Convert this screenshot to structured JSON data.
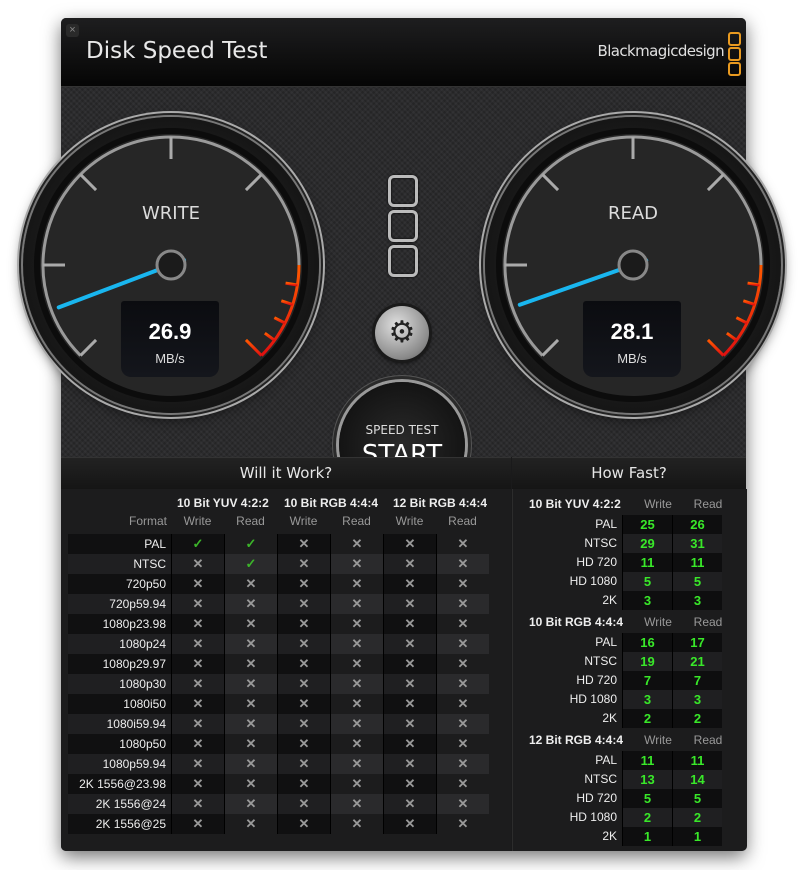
{
  "window": {
    "title": "Disk Speed Test",
    "brand": "Blackmagicdesign",
    "close_icon": "close-icon"
  },
  "gauges": {
    "write": {
      "label": "WRITE",
      "value": "26.9",
      "unit": "MB/s",
      "needle_fraction": 0.09
    },
    "read": {
      "label": "READ",
      "value": "28.1",
      "unit": "MB/s",
      "needle_fraction": 0.095
    }
  },
  "controls": {
    "settings_icon": "gear-icon",
    "start_sub": "SPEED TEST",
    "start_main": "START"
  },
  "will_it_work": {
    "title": "Will it Work?",
    "format_label": "Format",
    "groups": [
      "10 Bit YUV 4:2:2",
      "10 Bit RGB 4:4:4",
      "12 Bit RGB 4:4:4"
    ],
    "subcols": [
      "Write",
      "Read",
      "Write",
      "Read",
      "Write",
      "Read"
    ],
    "rows": [
      {
        "format": "PAL",
        "results": [
          true,
          true,
          false,
          false,
          false,
          false
        ]
      },
      {
        "format": "NTSC",
        "results": [
          false,
          true,
          false,
          false,
          false,
          false
        ]
      },
      {
        "format": "720p50",
        "results": [
          false,
          false,
          false,
          false,
          false,
          false
        ]
      },
      {
        "format": "720p59.94",
        "results": [
          false,
          false,
          false,
          false,
          false,
          false
        ]
      },
      {
        "format": "1080p23.98",
        "results": [
          false,
          false,
          false,
          false,
          false,
          false
        ]
      },
      {
        "format": "1080p24",
        "results": [
          false,
          false,
          false,
          false,
          false,
          false
        ]
      },
      {
        "format": "1080p29.97",
        "results": [
          false,
          false,
          false,
          false,
          false,
          false
        ]
      },
      {
        "format": "1080p30",
        "results": [
          false,
          false,
          false,
          false,
          false,
          false
        ]
      },
      {
        "format": "1080i50",
        "results": [
          false,
          false,
          false,
          false,
          false,
          false
        ]
      },
      {
        "format": "1080i59.94",
        "results": [
          false,
          false,
          false,
          false,
          false,
          false
        ]
      },
      {
        "format": "1080p50",
        "results": [
          false,
          false,
          false,
          false,
          false,
          false
        ]
      },
      {
        "format": "1080p59.94",
        "results": [
          false,
          false,
          false,
          false,
          false,
          false
        ]
      },
      {
        "format": "2K 1556@23.98",
        "results": [
          false,
          false,
          false,
          false,
          false,
          false
        ]
      },
      {
        "format": "2K 1556@24",
        "results": [
          false,
          false,
          false,
          false,
          false,
          false
        ]
      },
      {
        "format": "2K 1556@25",
        "results": [
          false,
          false,
          false,
          false,
          false,
          false
        ]
      }
    ],
    "check_glyph": "✓",
    "cross_glyph": "✕"
  },
  "how_fast": {
    "title": "How Fast?",
    "write_label": "Write",
    "read_label": "Read",
    "groups": [
      {
        "name": "10 Bit YUV 4:2:2",
        "rows": [
          {
            "label": "PAL",
            "write": "25",
            "read": "26"
          },
          {
            "label": "NTSC",
            "write": "29",
            "read": "31"
          },
          {
            "label": "HD 720",
            "write": "11",
            "read": "11"
          },
          {
            "label": "HD 1080",
            "write": "5",
            "read": "5"
          },
          {
            "label": "2K",
            "write": "3",
            "read": "3"
          }
        ]
      },
      {
        "name": "10 Bit RGB 4:4:4",
        "rows": [
          {
            "label": "PAL",
            "write": "16",
            "read": "17"
          },
          {
            "label": "NTSC",
            "write": "19",
            "read": "21"
          },
          {
            "label": "HD 720",
            "write": "7",
            "read": "7"
          },
          {
            "label": "HD 1080",
            "write": "3",
            "read": "3"
          },
          {
            "label": "2K",
            "write": "2",
            "read": "2"
          }
        ]
      },
      {
        "name": "12 Bit RGB 4:4:4",
        "rows": [
          {
            "label": "PAL",
            "write": "11",
            "read": "11"
          },
          {
            "label": "NTSC",
            "write": "13",
            "read": "14"
          },
          {
            "label": "HD 720",
            "write": "5",
            "read": "5"
          },
          {
            "label": "HD 1080",
            "write": "2",
            "read": "2"
          },
          {
            "label": "2K",
            "write": "1",
            "read": "1"
          }
        ]
      }
    ]
  },
  "colors": {
    "needle": "#19b6ef",
    "redzone_start": "#ff5a00",
    "redzone_end": "#e01010",
    "value_green": "#39e829",
    "logo_orange": "#e99a20"
  }
}
